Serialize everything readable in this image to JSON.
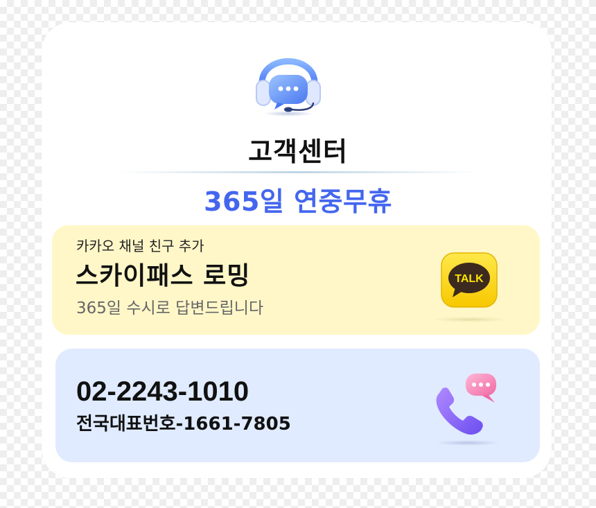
{
  "header": {
    "icon": "headset-chat-icon",
    "title": "고객센터",
    "subtitle": "365일 연중무휴"
  },
  "kakao": {
    "small_label": "카카오 채널 친구 추가",
    "name": "스카이패스 로밍",
    "description": "365일 수시로 답변드립니다",
    "icon": "kakaotalk-icon",
    "icon_text": "TALK"
  },
  "phone": {
    "number": "02-2243-1010",
    "representative": "전국대표번호-1661-7805",
    "icon": "phone-chat-icon"
  },
  "colors": {
    "accent": "#4466ee",
    "kakao_bg": "#fff7c8",
    "phone_bg": "#e0ebff",
    "kakao_yellow": "#fee500"
  }
}
